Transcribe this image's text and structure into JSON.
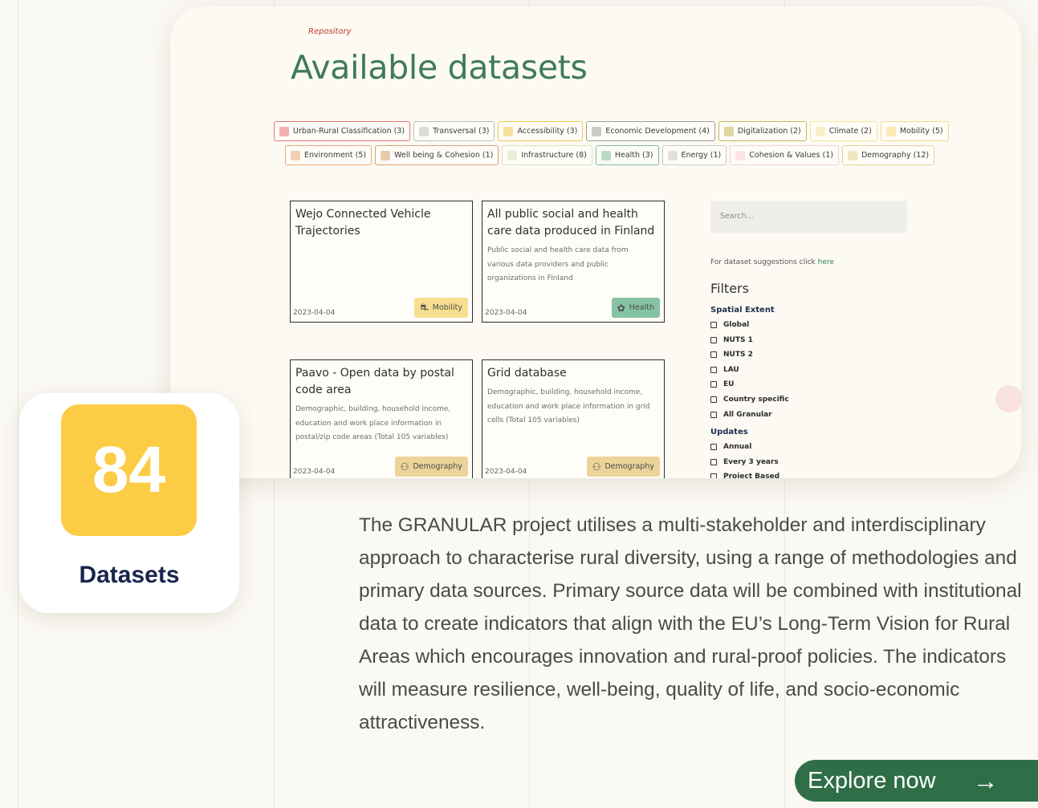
{
  "repository_page": {
    "breadcrumb": "Repository",
    "title": "Available datasets",
    "categories_row1": [
      {
        "label": "Urban-Rural Classification (3)",
        "color": "#e57373",
        "icon": "city-icon"
      },
      {
        "label": "Transversal (3)",
        "color": "#bdbdbd",
        "icon": "transversal-icon"
      },
      {
        "label": "Accessibility (3)",
        "color": "#f2c94c",
        "icon": "accessibility-icon"
      },
      {
        "label": "Economic Development (4)",
        "color": "#9e9e9e",
        "icon": "economy-icon"
      },
      {
        "label": "Digitalization (2)",
        "color": "#c9b458",
        "icon": "digital-icon"
      },
      {
        "label": "Climate (2)",
        "color": "#f5e39a",
        "icon": "climate-icon"
      },
      {
        "label": "Mobility (5)",
        "color": "#f5d982",
        "icon": "mobility-icon"
      }
    ],
    "categories_row2": [
      {
        "label": "Environment (5)",
        "color": "#e8a87c",
        "icon": "environment-icon"
      },
      {
        "label": "Well being & Cohesion (1)",
        "color": "#d4a373",
        "icon": "wellbeing-icon"
      },
      {
        "label": "Infrastructure (8)",
        "color": "#d8e4b8",
        "icon": "infrastructure-icon"
      },
      {
        "label": "Health (3)",
        "color": "#7fb99a",
        "icon": "health-icon"
      },
      {
        "label": "Energy (1)",
        "color": "#c9c9c9",
        "icon": "energy-icon"
      },
      {
        "label": "Cohesion & Values (1)",
        "color": "#f5cfcf",
        "icon": "cohesion-icon"
      },
      {
        "label": "Demography (12)",
        "color": "#e9cf95",
        "icon": "demography-icon"
      }
    ],
    "datasets": [
      {
        "title": "Wejo Connected Vehicle Trajectories",
        "description": "",
        "date": "2023-04-04",
        "tag": "Mobility",
        "tag_color": "#f7df8f"
      },
      {
        "title": "All public social and health care data produced in Finland",
        "description": "Public social and health care data from various data providers and public organizations in Finland",
        "date": "2023-04-04",
        "tag": "Health",
        "tag_color": "#86c3a4"
      },
      {
        "title": "Paavo - Open data by postal code area",
        "description": "Demographic, building, household income, education and work place information in postal/zip code areas (Total 105 variables)",
        "date": "2023-04-04",
        "tag": "Demography",
        "tag_color": "#ecd39a"
      },
      {
        "title": "Grid database",
        "description": "Demographic, building, household income, education and work place information in grid cells (Total 105 variables)",
        "date": "2023-04-04",
        "tag": "Demography",
        "tag_color": "#ecd39a"
      }
    ],
    "search_placeholder": "Search...",
    "suggestion_text": "For dataset suggestions click",
    "suggestion_link": "here",
    "filters_heading": "Filters",
    "spatial_extent_heading": "Spatial Extent",
    "spatial_extent_options": [
      "Global",
      "NUTS 1",
      "NUTS 2",
      "LAU",
      "EU",
      "Country specific",
      "All Granular"
    ],
    "updates_heading": "Updates",
    "updates_options": [
      "Annual",
      "Every 3 years",
      "Project Based"
    ]
  },
  "stat": {
    "number": "84",
    "label": "Datasets",
    "color": "#fccc45"
  },
  "description": "The GRANULAR project utilises a multi-stakeholder and interdisciplinary approach to characterise rural diversity, using a range of methodologies and primary data sources. Primary source data will be combined with institutional data to create indicators that align with the EU’s Long-Term Vision for Rural Areas which encourages innovation and rural-proof policies. The indicators will measure resilience, well-being, quality of life, and socio-economic attractiveness.",
  "cta": {
    "label": "Explore now",
    "icon": "arrow-right-icon",
    "color": "#2f6e47"
  }
}
